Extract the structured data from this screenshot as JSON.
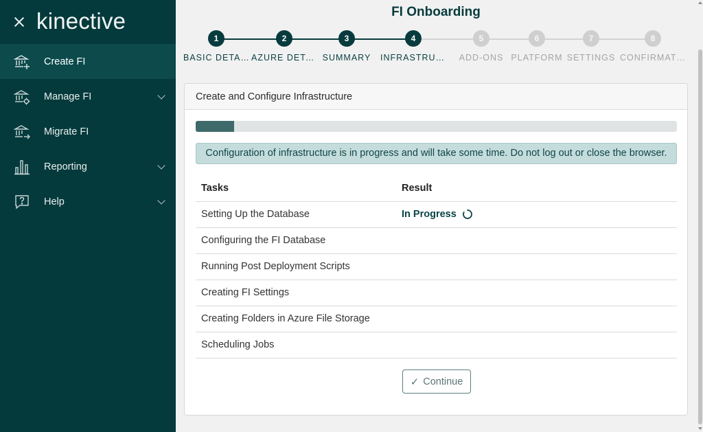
{
  "brand": {
    "logo_text": "kinective"
  },
  "sidebar": {
    "items": [
      {
        "label": "Create FI",
        "icon": "bank-plus-icon",
        "active": true,
        "has_submenu": false
      },
      {
        "label": "Manage FI",
        "icon": "bank-gear-icon",
        "active": false,
        "has_submenu": true
      },
      {
        "label": "Migrate FI",
        "icon": "bank-arrow-icon",
        "active": false,
        "has_submenu": false
      },
      {
        "label": "Reporting",
        "icon": "bar-chart-icon",
        "active": false,
        "has_submenu": true
      },
      {
        "label": "Help",
        "icon": "help-bubble-icon",
        "active": false,
        "has_submenu": true
      }
    ]
  },
  "page": {
    "title": "FI Onboarding"
  },
  "stepper": {
    "steps": [
      {
        "number": "1",
        "label": "BASIC DETAILS",
        "status": "done"
      },
      {
        "number": "2",
        "label": "AZURE DETAILS",
        "status": "done"
      },
      {
        "number": "3",
        "label": "SUMMARY",
        "status": "done"
      },
      {
        "number": "4",
        "label": "INFRASTRUCTURE",
        "status": "current"
      },
      {
        "number": "5",
        "label": "ADD-ONS",
        "status": "todo"
      },
      {
        "number": "6",
        "label": "PLATFORM",
        "status": "todo"
      },
      {
        "number": "7",
        "label": "SETTINGS",
        "status": "todo"
      },
      {
        "number": "8",
        "label": "CONFIRMATION",
        "status": "todo"
      }
    ]
  },
  "card": {
    "title": "Create and Configure Infrastructure",
    "progress_fraction": 0.08,
    "alert": "Configuration of infrastructure is in progress and will take some time. Do not log out or close the browser.",
    "table": {
      "headers": [
        "Tasks",
        "Result"
      ],
      "rows": [
        {
          "task": "Setting Up the Database",
          "result": "In Progress"
        },
        {
          "task": "Configuring the FI Database",
          "result": ""
        },
        {
          "task": "Running Post Deployment Scripts",
          "result": ""
        },
        {
          "task": "Creating FI Settings",
          "result": ""
        },
        {
          "task": "Creating Folders in Azure File Storage",
          "result": ""
        },
        {
          "task": "Scheduling Jobs",
          "result": ""
        }
      ]
    },
    "continue_label": "Continue",
    "continue_icon": "checkmark-icon"
  },
  "colors": {
    "sidebar_bg": "#053a3c",
    "accent": "#083b3d",
    "inactive_step": "#cfcfcf",
    "alert_bg": "#c5dcdc"
  }
}
